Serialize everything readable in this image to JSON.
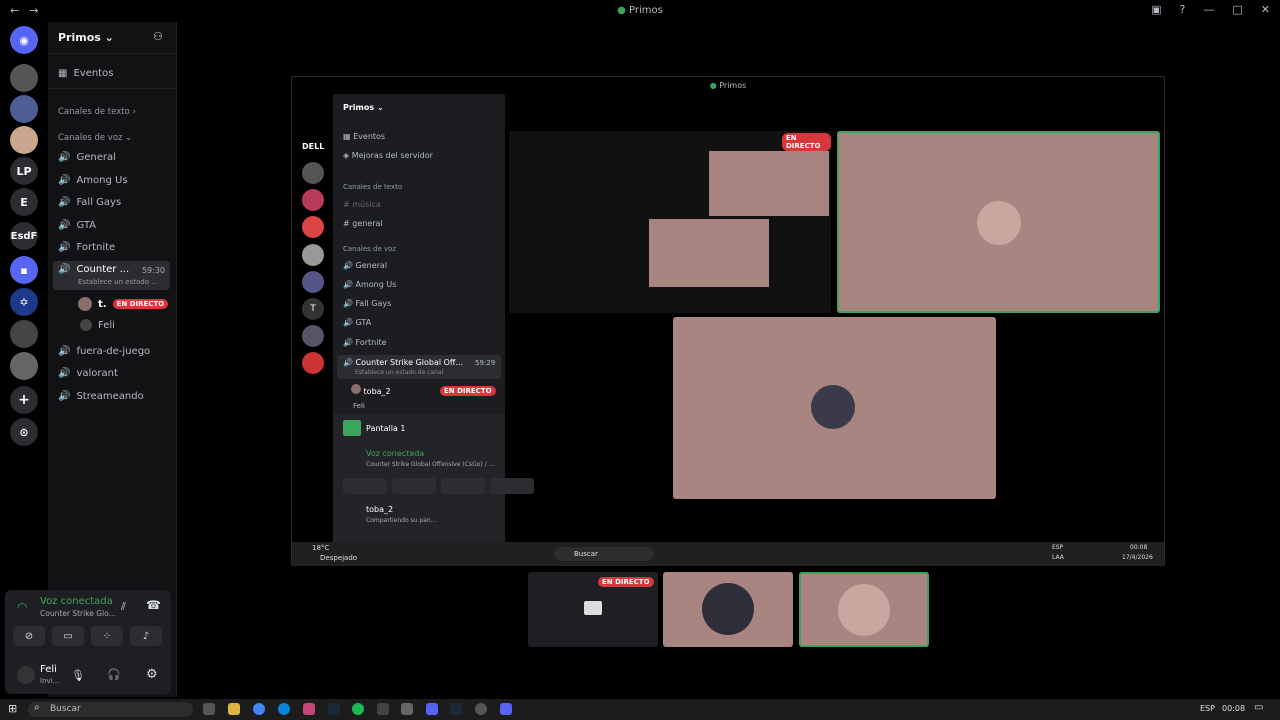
{
  "window": {
    "title": "Primos"
  },
  "rail": {
    "items": [
      "LP",
      "E",
      "EsdF"
    ]
  },
  "server": {
    "name": "Primos"
  },
  "channels": {
    "events": "Eventos",
    "text_category": "Canales de texto",
    "voice_category": "Canales de voz",
    "voice": [
      "General",
      "Among Us",
      "Fall Gays",
      "GTA",
      "Fortnite"
    ],
    "active": {
      "name": "Counter ...",
      "timer": "59:30",
      "status": "Establece un estado ..."
    },
    "members": [
      {
        "name": "t.",
        "badge": "EN DIRECTO"
      },
      {
        "name": "Feli"
      }
    ],
    "more": [
      "fuera-de-juego",
      "valorant",
      "Streameando"
    ]
  },
  "voice_panel": {
    "title": "Voz conectada",
    "subtitle": "Counter Strike Glo..."
  },
  "user": {
    "name": "Feli",
    "status": "Invi..."
  },
  "stream": {
    "title": "Primos",
    "server": "Primos",
    "events": "Eventos",
    "boost": "Mejoras del servidor",
    "text_category": "Canales de texto",
    "text_channels": [
      "música",
      "general"
    ],
    "voice_category": "Canales de voz",
    "voice_channels": [
      "General",
      "Among Us",
      "Fall Gays",
      "GTA",
      "Fortnite"
    ],
    "active_channel": "Counter Strike Global Off...",
    "active_timer": "59:29",
    "active_status": "Establece un estado de canal",
    "member1": "toba_2",
    "member1_badge": "EN DIRECTO",
    "member2": "Feli",
    "screen": "Pantalla 1",
    "voice_title": "Voz conectada",
    "voice_sub": "Counter Strike Global Offensive (CsGo) / ...",
    "user": "toba_2",
    "user_status": "Compartiendo su pan...",
    "dell": "DELL",
    "weather_temp": "18°C",
    "weather_desc": "Despejado",
    "search": "Buscar",
    "lang": "ESP",
    "lang2": "LAA",
    "time": "00:08",
    "date": "17/4/2026",
    "live_badge": "EN DIRECTO"
  },
  "bottom_live": "EN DIRECTO",
  "taskbar": {
    "search": "Buscar",
    "lang": "ESP",
    "time": "00:08"
  }
}
